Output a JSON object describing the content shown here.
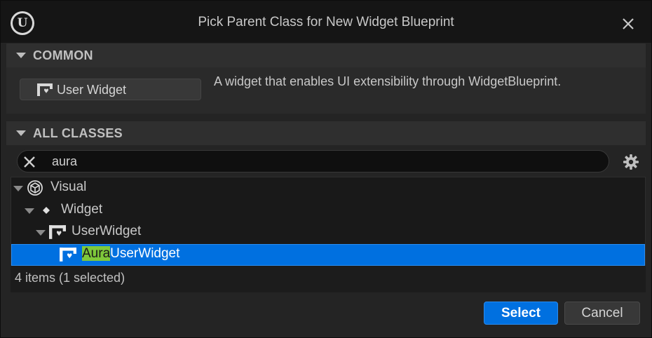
{
  "window": {
    "title": "Pick Parent Class for New Widget Blueprint",
    "logo_text": "U"
  },
  "common": {
    "header": "COMMON",
    "button_label": "User Widget",
    "description": "A widget that enables UI extensibility through WidgetBlueprint."
  },
  "all_classes": {
    "header": "ALL CLASSES",
    "search_value": "aura",
    "tree": [
      {
        "label": "Visual",
        "icon": "cube-icon",
        "expanded": true
      },
      {
        "label": "Widget",
        "icon": "diamond-icon",
        "expanded": true
      },
      {
        "label": "UserWidget",
        "icon": "user-widget-icon",
        "expanded": true
      },
      {
        "label_highlight": "Aura",
        "label_rest": "UserWidget",
        "icon": "user-widget-icon",
        "selected": true
      }
    ],
    "status": "4 items (1 selected)"
  },
  "buttons": {
    "select": "Select",
    "cancel": "Cancel"
  },
  "colors": {
    "accent": "#0070e0",
    "highlight": "#7ec83a",
    "background": "#242424"
  }
}
